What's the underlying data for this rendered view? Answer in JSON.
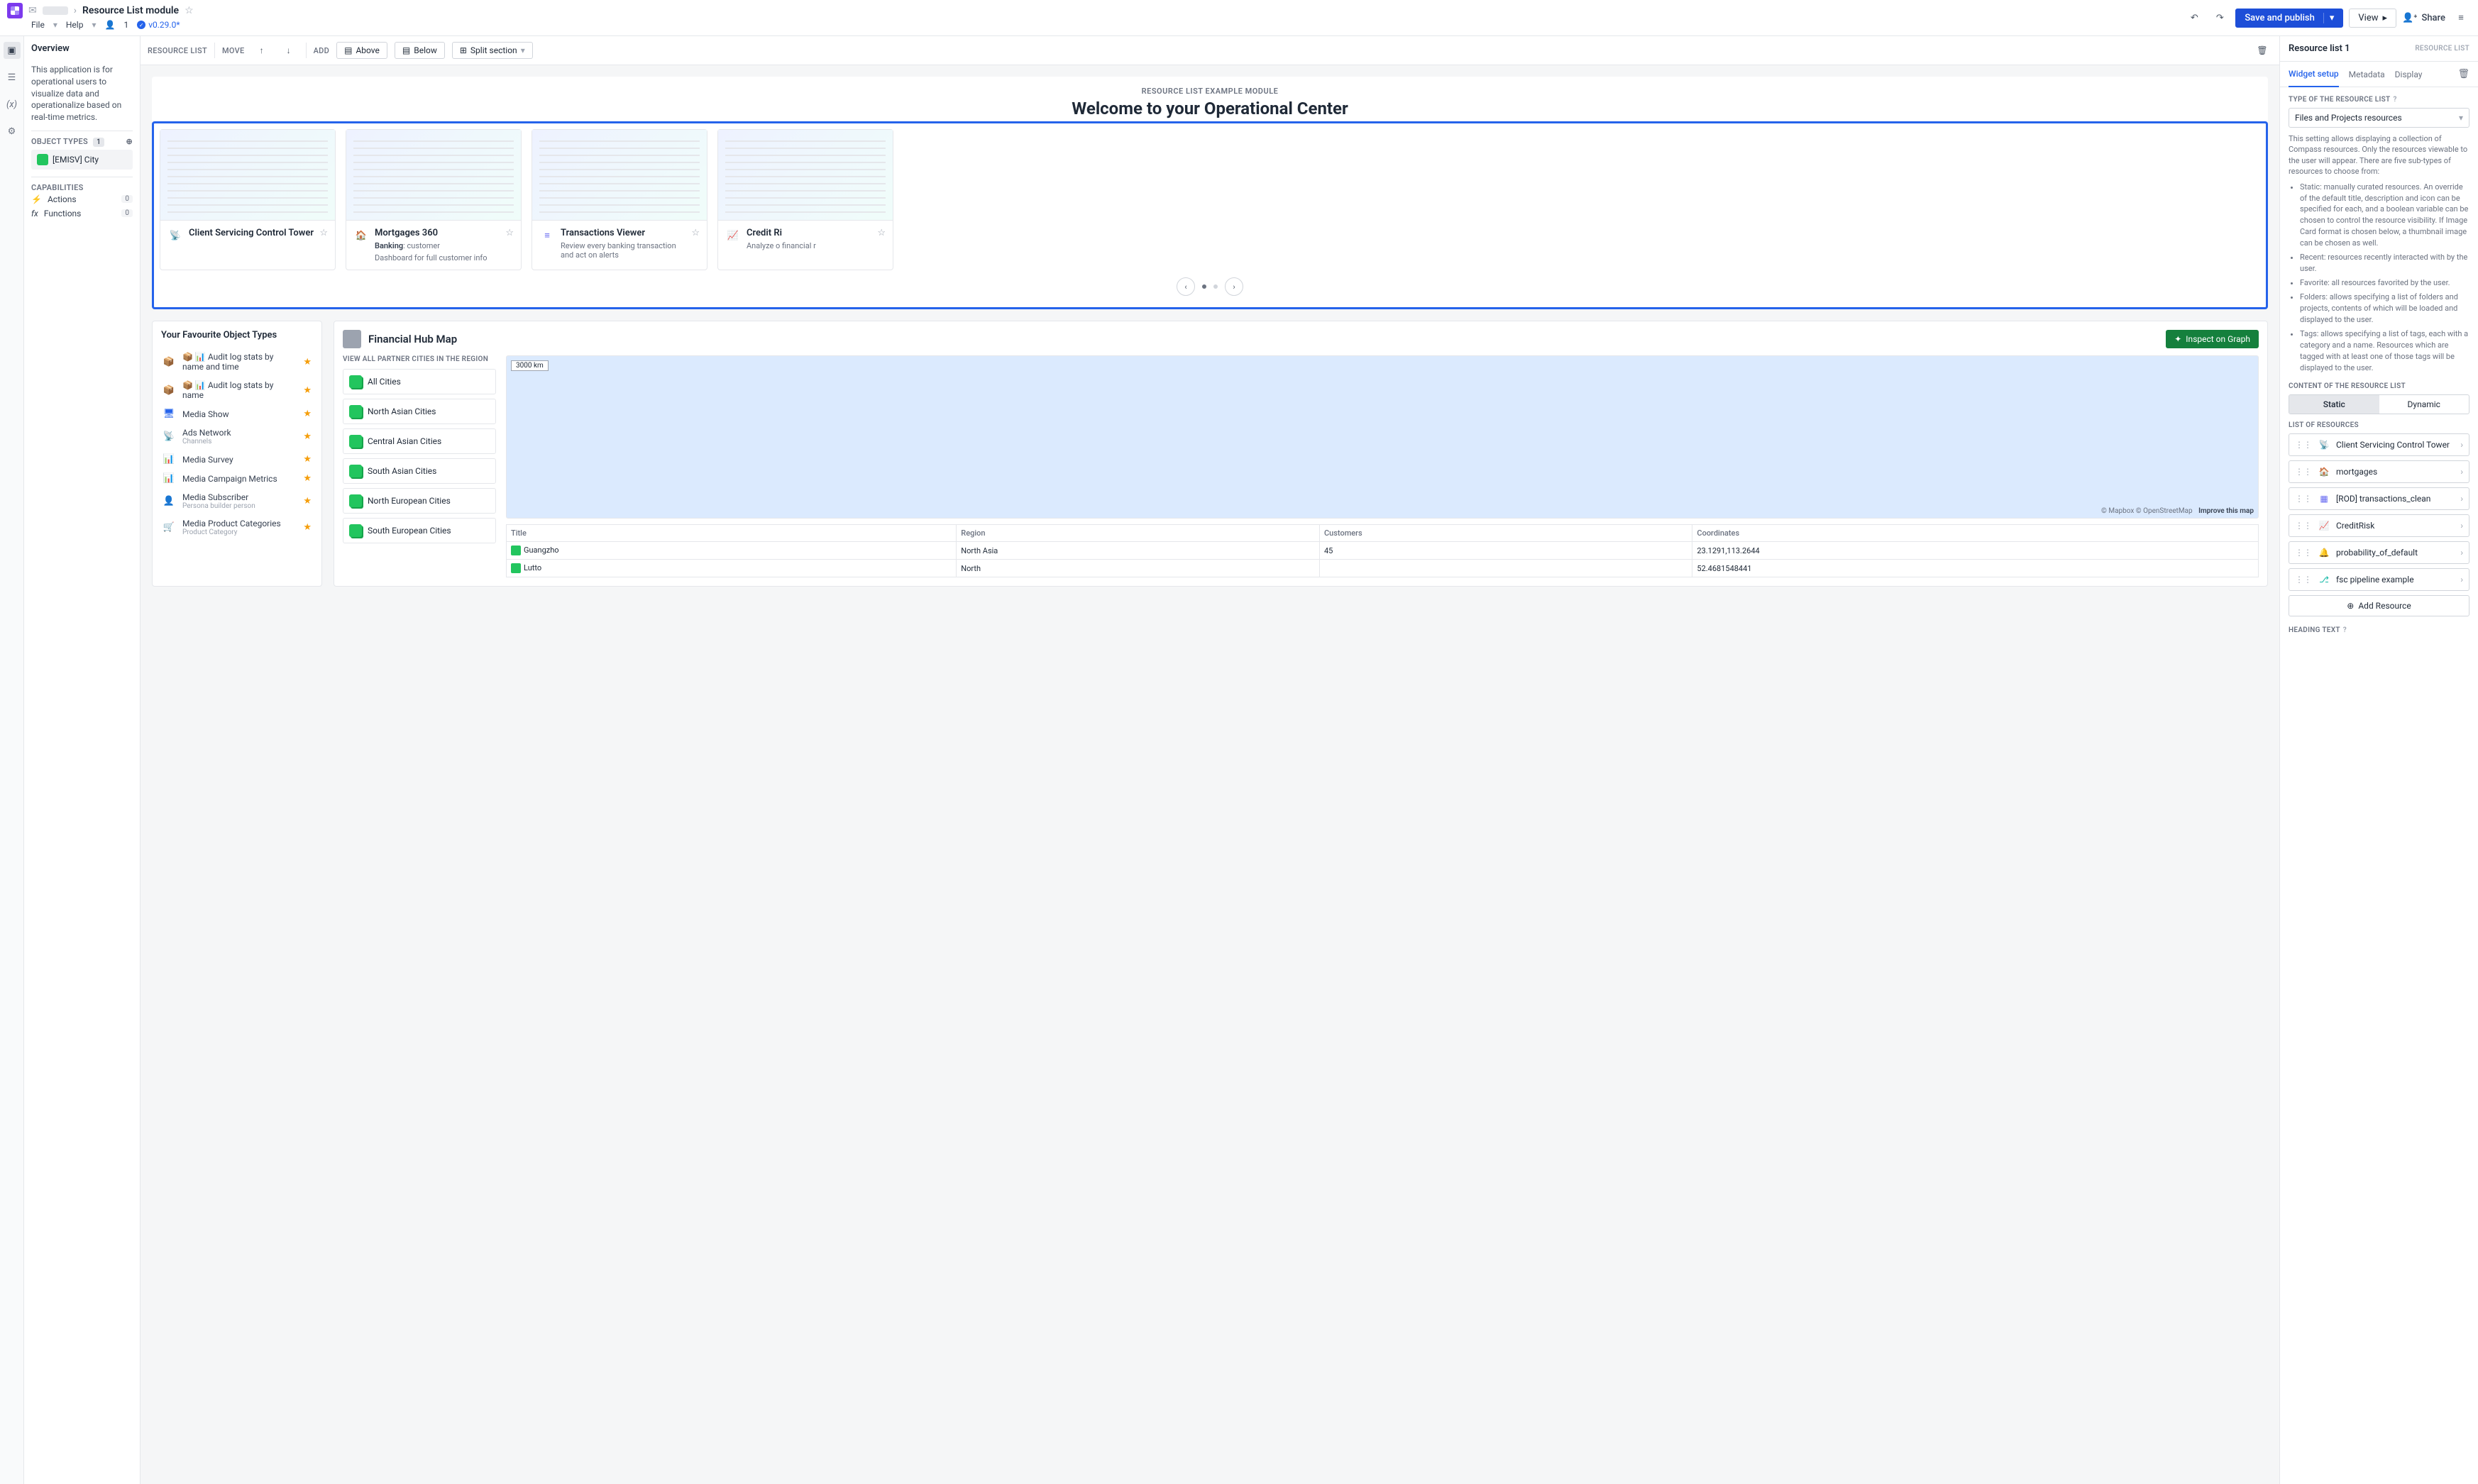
{
  "breadcrumb": {
    "section": "",
    "title": "Resource List module"
  },
  "menu": {
    "file": "File",
    "help": "Help",
    "users": "1",
    "version": "v0.29.0*"
  },
  "topbar": {
    "save": "Save and publish",
    "view": "View",
    "share": "Share"
  },
  "left": {
    "overview": "Overview",
    "desc": "This application is for operational users to visualize data and operationalize based on real-time metrics.",
    "object_types_label": "OBJECT TYPES",
    "object_types_count": "1",
    "object_type": "[EMISV] City",
    "capabilities": "CAPABILITIES",
    "actions": "Actions",
    "actions_cnt": "0",
    "functions": "Functions",
    "functions_cnt": "0"
  },
  "actionbar": {
    "resource_list": "RESOURCE LIST",
    "move": "MOVE",
    "add": "ADD",
    "above": "Above",
    "below": "Below",
    "split": "Split section"
  },
  "hero": {
    "kicker": "RESOURCE LIST EXAMPLE MODULE",
    "title": "Welcome to your Operational Center"
  },
  "cards": [
    {
      "title": "Client Servicing  Control Tower",
      "sub": "",
      "desc": ""
    },
    {
      "title": "Mortgages 360",
      "sub_strong": "Banking",
      "sub_rest": ": customer",
      "desc": "Dashboard for full customer info"
    },
    {
      "title": "Transactions Viewer",
      "sub": "",
      "desc": "Review every banking transaction and act on alerts"
    },
    {
      "title": "Credit Ri",
      "sub": "",
      "desc": "Analyze o\nfinancial r"
    }
  ],
  "fav": {
    "title": "Your Favourite Object Types",
    "items": [
      {
        "label": "📦 📊 Audit log stats by name and time",
        "sub": ""
      },
      {
        "label": "📦 📊 Audit log stats by name",
        "sub": ""
      },
      {
        "label": "Media Show",
        "sub": ""
      },
      {
        "label": "Ads Network",
        "sub": "Channels"
      },
      {
        "label": "Media Survey",
        "sub": ""
      },
      {
        "label": "Media Campaign Metrics",
        "sub": ""
      },
      {
        "label": "Media Subscriber",
        "sub": "Persona builder person"
      },
      {
        "label": "Media Product Categories",
        "sub": "Product Category"
      }
    ]
  },
  "map": {
    "title": "Financial Hub Map",
    "inspect": "Inspect on Graph",
    "region_header": "VIEW ALL PARTNER CITIES IN THE REGION",
    "regions": [
      "All Cities",
      "North Asian Cities",
      "Central Asian Cities",
      "South Asian Cities",
      "North European Cities",
      "South European Cities"
    ],
    "scale": "3000 km",
    "attr1": "© Mapbox © OpenStreetMap",
    "attr2": "Improve this map",
    "cols": [
      "Title",
      "Region",
      "Customers",
      "Coordinates"
    ],
    "rows": [
      {
        "title": "Guangzho",
        "region": "North Asia",
        "customers": "45",
        "coords": "23.1291,113.2644"
      },
      {
        "title": "Lutto",
        "region": "North",
        "customers": "",
        "coords": "52.4681548441"
      }
    ]
  },
  "right": {
    "title": "Resource list 1",
    "tag": "RESOURCE LIST",
    "tabs": [
      "Widget setup",
      "Metadata",
      "Display"
    ],
    "type_label": "TYPE OF THE RESOURCE LIST",
    "type_value": "Files and Projects resources",
    "para": "This setting allows displaying a collection of Compass resources. Only the resources viewable to the user will appear. There are five sub-types of resources to choose from:",
    "bullets": [
      "Static: manually curated resources. An override of the default title, description and icon can be specified for each, and a boolean variable can be chosen to control the resource visibility. If Image Card format is chosen below, a thumbnail image can be chosen as well.",
      "Recent: resources recently interacted with by the user.",
      "Favorite: all resources favorited by the user.",
      "Folders: allows specifying a list of folders and projects, contents of which will be loaded and displayed to the user.",
      "Tags: allows specifying a list of tags, each with a category and a name. Resources which are tagged with at least one of those tags will be displayed to the user."
    ],
    "content_label": "CONTENT OF THE RESOURCE LIST",
    "seg": [
      "Static",
      "Dynamic"
    ],
    "lor": "LIST OF RESOURCES",
    "items": [
      {
        "label": "Client Servicing Control Tower",
        "color": "#374151"
      },
      {
        "label": "mortgages",
        "color": "#374151"
      },
      {
        "label": "[ROD] transactions_clean",
        "color": "#6366f1"
      },
      {
        "label": "CreditRisk",
        "color": "#dc2626"
      },
      {
        "label": "probability_of_default",
        "color": "#f59e0b"
      },
      {
        "label": "fsc pipeline example",
        "color": "#14b8a6"
      }
    ],
    "add": "Add Resource",
    "heading_text": "HEADING TEXT"
  }
}
